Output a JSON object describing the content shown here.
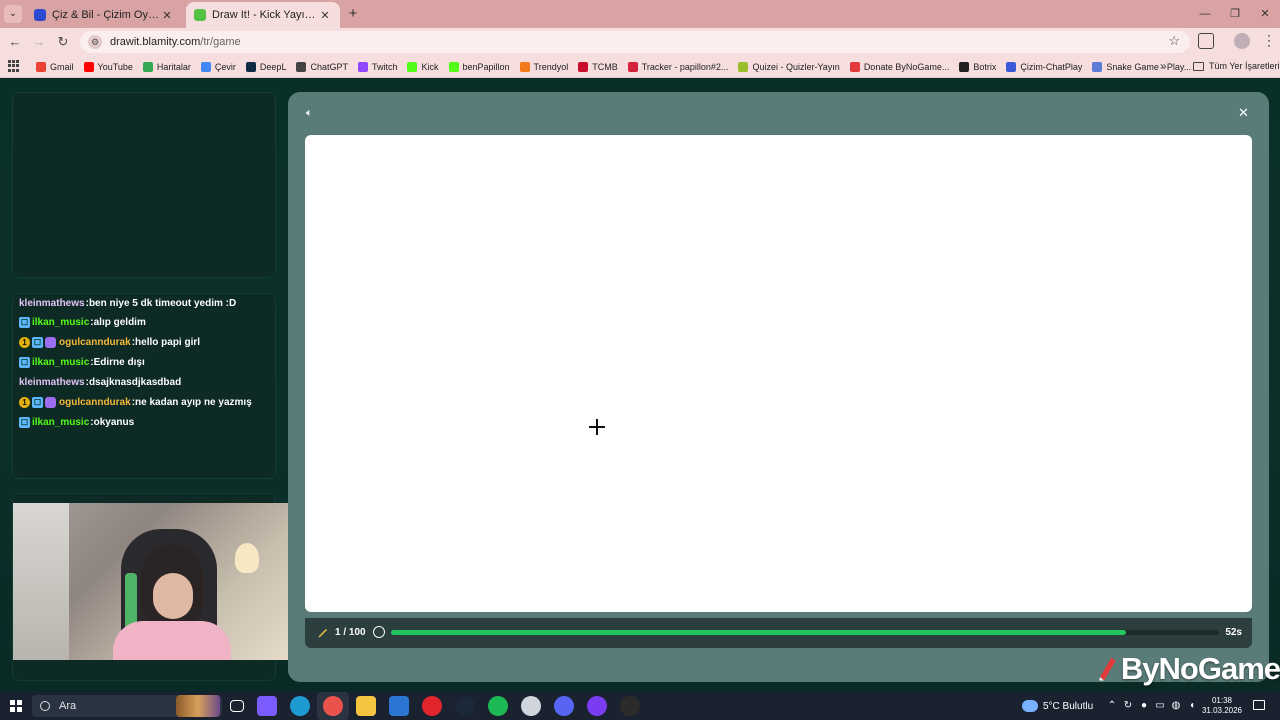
{
  "browser": {
    "tabs": [
      {
        "label": "Çiz & Bil - Çizim Oyunu",
        "icon": "gamepad-icon",
        "icon_color": "#2d4bd1",
        "active": false
      },
      {
        "label": "Draw It! - Kick Yayınları İçin Çizim",
        "icon": "brush-icon",
        "icon_color": "#53c243",
        "active": true
      }
    ],
    "new_tab": "+",
    "url_host": "drawit.blamity.com",
    "url_path": "/tr/game",
    "bookmarks": [
      {
        "label": "Gmail",
        "icon_color": "#ea4335"
      },
      {
        "label": "YouTube",
        "icon_color": "#ff0000"
      },
      {
        "label": "Haritalar",
        "icon_color": "#34a853"
      },
      {
        "label": "Çevir",
        "icon_color": "#4285f4"
      },
      {
        "label": "DeepL",
        "icon_color": "#0f2b46"
      },
      {
        "label": "ChatGPT",
        "icon_color": "#444444"
      },
      {
        "label": "Twitch",
        "icon_color": "#9146ff"
      },
      {
        "label": "Kick",
        "icon_color": "#53fc18"
      },
      {
        "label": "benPapillon",
        "icon_color": "#53fc18"
      },
      {
        "label": "Trendyol",
        "icon_color": "#f27a1a"
      },
      {
        "label": "TCMB",
        "icon_color": "#c8102e"
      },
      {
        "label": "Tracker - papillon#2...",
        "icon_color": "#d3223b"
      },
      {
        "label": "Quizei - Quizler-Yayın",
        "icon_color": "#9bbf2c"
      },
      {
        "label": "Donate ByNoGame...",
        "icon_color": "#e23a3a"
      },
      {
        "label": "Botrix",
        "icon_color": "#222222"
      },
      {
        "label": "Çizim-ChatPlay",
        "icon_color": "#3a5bd9"
      },
      {
        "label": "Snake Game - Play...",
        "icon_color": "#5b7bd6"
      }
    ],
    "all_bookmarks": "Tüm Yer İşaretleri"
  },
  "chat": {
    "messages": [
      {
        "badges": [],
        "user": "kleinmathews",
        "user_color": "#e2c3f5",
        "text": "ben niye 5 dk timeout yedim :D"
      },
      {
        "badges": [
          "sub"
        ],
        "user": "ilkan_music",
        "user_color": "#53fc18",
        "text": "alıp geldim"
      },
      {
        "badges": [
          "mod",
          "sub",
          "gift"
        ],
        "user": "ogulcanndurak",
        "user_color": "#f4b83a",
        "text": "hello papi girl"
      },
      {
        "badges": [
          "sub"
        ],
        "user": "ilkan_music",
        "user_color": "#53fc18",
        "text": "Edirne dışı"
      },
      {
        "badges": [],
        "user": "kleinmathews",
        "user_color": "#e2c3f5",
        "text": "dsajknasdjkasdbad"
      },
      {
        "badges": [
          "mod",
          "sub",
          "gift"
        ],
        "user": "ogulcanndurak",
        "user_color": "#f4b83a",
        "text": "ne kadan ayıp ne yazmış"
      },
      {
        "badges": [
          "sub"
        ],
        "user": "ilkan_music",
        "user_color": "#53fc18",
        "text": "okyanus"
      }
    ]
  },
  "game": {
    "round_label": "1 / 100",
    "time_label": "52s",
    "progress_fraction": 0.888,
    "accent_color": "#22c55e"
  },
  "watermark": {
    "text": "ByNoGame"
  },
  "taskbar": {
    "search_placeholder": "Ara",
    "apps": [
      {
        "name": "task-view-icon",
        "color": "#1a2230"
      },
      {
        "name": "copilot-icon",
        "color": "#7b5cff"
      },
      {
        "name": "edge-icon",
        "color": "#1d9bd1"
      },
      {
        "name": "chrome-icon",
        "color": "#e8453c",
        "active": true
      },
      {
        "name": "file-explorer-icon",
        "color": "#f5c542"
      },
      {
        "name": "mail-icon",
        "color": "#2a76d2"
      },
      {
        "name": "opera-icon",
        "color": "#e0262c"
      },
      {
        "name": "steam-icon",
        "color": "#1b2838"
      },
      {
        "name": "spotify-icon",
        "color": "#1db954"
      },
      {
        "name": "globe-icon",
        "color": "#d0d4dc"
      },
      {
        "name": "discord-icon",
        "color": "#5865f2"
      },
      {
        "name": "circle-app-icon",
        "color": "#7a3cf0"
      },
      {
        "name": "obs-icon",
        "color": "#2b2b2b"
      }
    ],
    "weather_text": "5°C  Bulutlu",
    "time": "01:38",
    "date": "31.03.2026"
  }
}
